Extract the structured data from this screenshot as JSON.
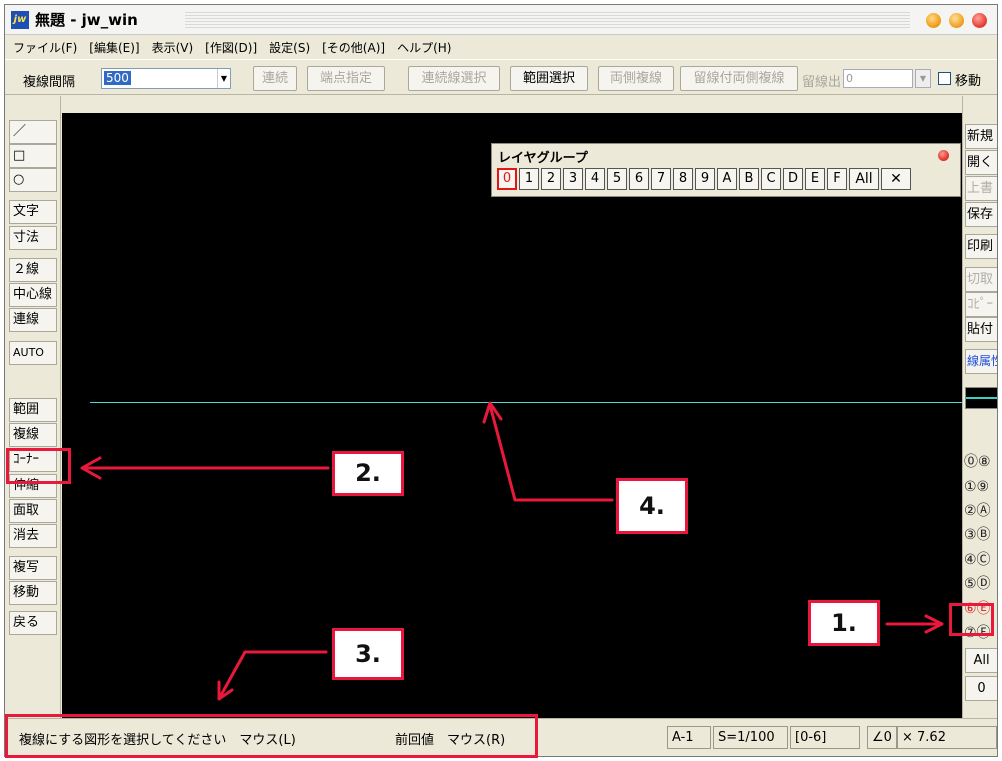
{
  "window": {
    "icon_text": "jw",
    "title": "無題 - jw_win"
  },
  "menu": [
    "ファイル(F)",
    "[編集(E)]",
    "表示(V)",
    "[作図(D)]",
    "設定(S)",
    "[その他(A)]",
    "ヘルプ(H)"
  ],
  "toolbar": {
    "spacing_label": "複線間隔",
    "spacing_value": "500",
    "buttons": [
      {
        "label": "連続",
        "enabled": false
      },
      {
        "label": "端点指定",
        "enabled": false
      },
      {
        "label": "連続線選択",
        "enabled": false
      },
      {
        "label": "範囲選択",
        "enabled": true
      },
      {
        "label": "両側複線",
        "enabled": false
      },
      {
        "label": "留線付両側複線",
        "enabled": false
      },
      {
        "label": "留線出",
        "enabled": false
      }
    ],
    "last_value": "0",
    "move_label": "移動",
    "move_checked": false
  },
  "left_tools": [
    "／",
    "□",
    "○",
    "文字",
    "寸法",
    "２線",
    "中心線",
    "連線",
    "AUTO",
    "範囲",
    "複線",
    "ｺｰﾅｰ",
    "伸縮",
    "面取",
    "消去",
    "複写",
    "移動",
    "戻る"
  ],
  "right_tools": [
    {
      "label": "新規",
      "enabled": true
    },
    {
      "label": "開く",
      "enabled": true
    },
    {
      "label": "上書",
      "enabled": false
    },
    {
      "label": "保存",
      "enabled": true
    },
    {
      "label": "印刷",
      "enabled": true
    },
    {
      "label": "切取",
      "enabled": false
    },
    {
      "label": "ｺﾋﾟｰ",
      "enabled": false
    },
    {
      "label": "貼付",
      "enabled": true
    },
    {
      "label": "線属性",
      "enabled": true
    }
  ],
  "layers": {
    "rows": [
      "⓪⑧",
      "①⑨",
      "②Ⓐ",
      "③Ⓑ",
      "④Ⓒ",
      "⑤Ⓓ",
      "⑥Ⓔ",
      "⑦Ⓕ"
    ],
    "all_label": "All",
    "current_layer": "0",
    "highlighted": "⑥"
  },
  "layer_group": {
    "title": "レイヤグループ",
    "buttons": [
      "0",
      "1",
      "2",
      "3",
      "4",
      "5",
      "6",
      "7",
      "8",
      "9",
      "A",
      "B",
      "C",
      "D",
      "E",
      "F"
    ],
    "active": "0",
    "all_label": "All",
    "cancel_symbol": "✕"
  },
  "status": {
    "message": "複線にする図形を選択してください",
    "mouse_left": "マウス(L)",
    "previous_value": "前回値",
    "mouse_right": "マウス(R)",
    "paper": "A-1",
    "scale": "S=1/100",
    "layer_range": "[0-6]",
    "angle": "∠0",
    "multiplier": "× 7.62"
  },
  "annotations": [
    "1.",
    "2.",
    "3.",
    "4."
  ],
  "colors": {
    "accent_red": "#e8193b",
    "canvas": "#000000",
    "line_cyan": "#4fd5d0"
  }
}
